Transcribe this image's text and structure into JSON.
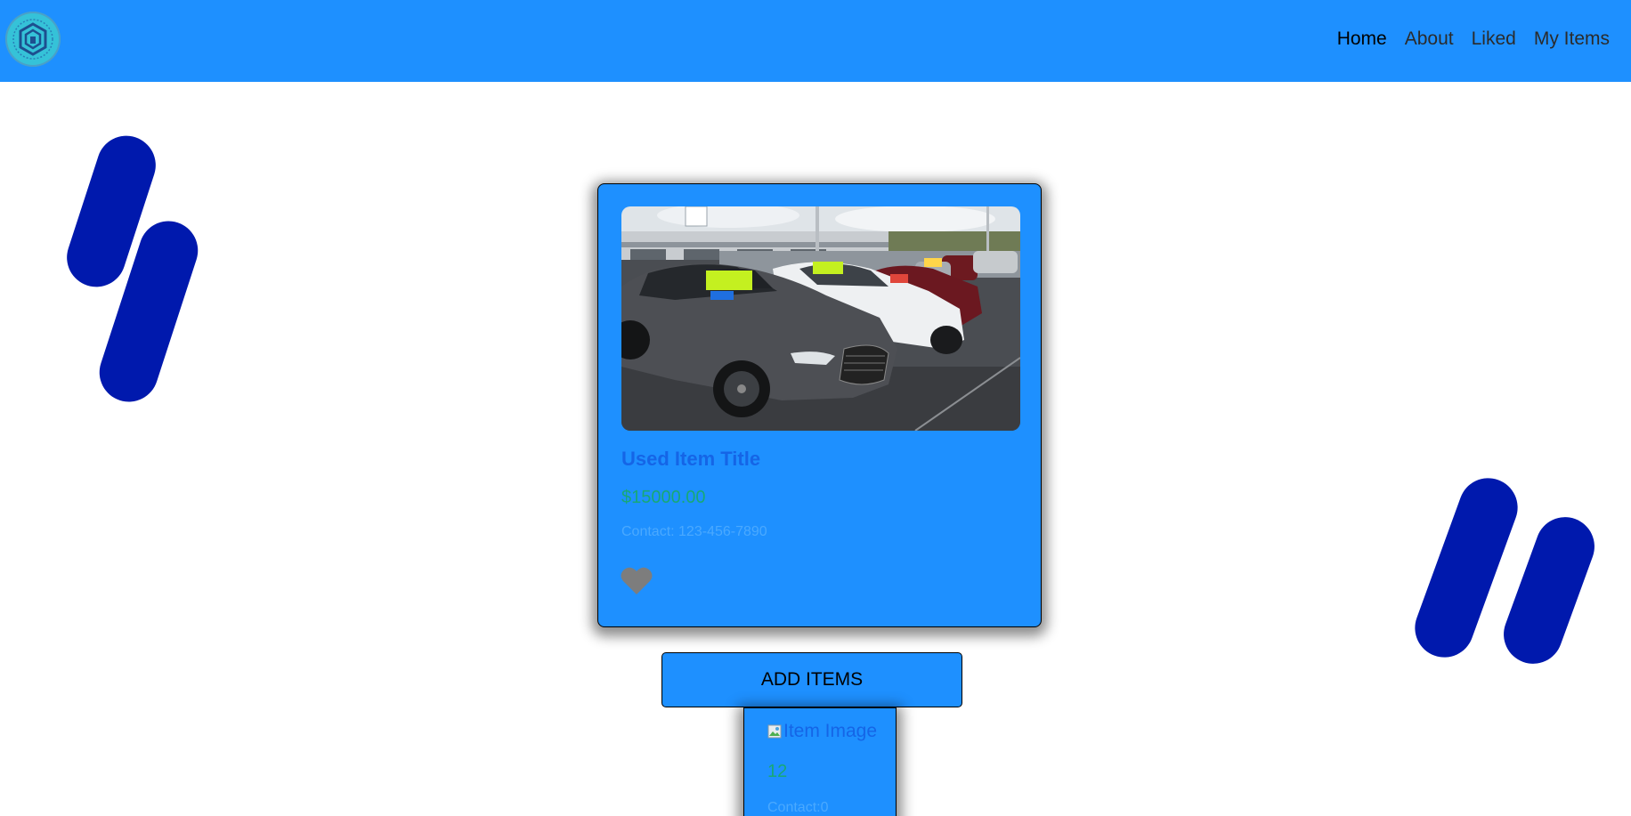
{
  "navbar": {
    "logo_icon": "circular-brand-logo",
    "links": [
      {
        "label": "Home"
      },
      {
        "label": "About"
      },
      {
        "label": "Liked"
      },
      {
        "label": "My Items"
      }
    ],
    "active": "Home"
  },
  "card": {
    "image_icon": "car-lot-photo",
    "title": "Used Item Title",
    "price": "$15000.00",
    "contact": "Contact: 123-456-7890",
    "like_icon": "heart-icon"
  },
  "add_items": {
    "label": "ADD ITEMS"
  },
  "second_card": {
    "image_alt": "Item Image",
    "price": "12",
    "contact": "Contact:0"
  },
  "colors": {
    "primary": "#1e90ff",
    "decor": "#0019ad",
    "title": "#1565e6",
    "price": "#18a876"
  }
}
